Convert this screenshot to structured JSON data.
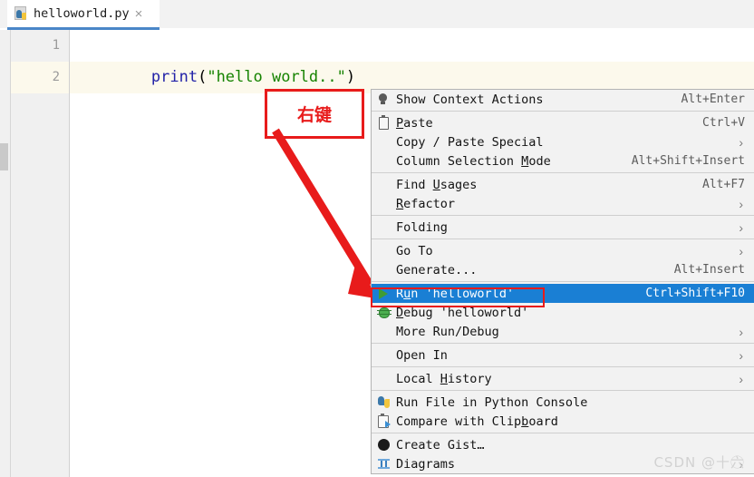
{
  "tab": {
    "filename": "helloworld.py",
    "icon": "python-file-icon",
    "close": "×",
    "underline_color": "#4a86c8"
  },
  "editor": {
    "lines": [
      {
        "number": "1",
        "highlighted": false
      },
      {
        "number": "2",
        "highlighted": true
      }
    ],
    "code": {
      "fn": "print",
      "open_paren": "(",
      "string": "\"hello world..\"",
      "close_paren": ")"
    },
    "colors": {
      "function": "#2222a8",
      "string": "#168300",
      "current_line": "#fcf9ec",
      "gutter": "#f0f0f0"
    }
  },
  "context_menu": {
    "selected_index": 11,
    "selection_color": "#1a7fd4",
    "items": [
      {
        "icon": "lightbulb-icon",
        "label": "Show Context Actions",
        "mnemonic": "",
        "shortcut": "Alt+Enter",
        "submenu": false,
        "separator_after": true
      },
      {
        "icon": "clipboard-paste-icon",
        "label": "Paste",
        "mnemonic": "P",
        "shortcut": "Ctrl+V",
        "submenu": false,
        "separator_after": false
      },
      {
        "icon": "",
        "label": "Copy / Paste Special",
        "mnemonic": "",
        "shortcut": "",
        "submenu": true,
        "separator_after": false
      },
      {
        "icon": "",
        "label": "Column Selection Mode",
        "mnemonic": "M",
        "shortcut": "Alt+Shift+Insert",
        "submenu": false,
        "separator_after": true
      },
      {
        "icon": "",
        "label": "Find Usages",
        "mnemonic": "U",
        "shortcut": "Alt+F7",
        "submenu": false,
        "separator_after": false
      },
      {
        "icon": "",
        "label": "Refactor",
        "mnemonic": "R",
        "shortcut": "",
        "submenu": true,
        "separator_after": true
      },
      {
        "icon": "",
        "label": "Folding",
        "mnemonic": "",
        "shortcut": "",
        "submenu": true,
        "separator_after": true
      },
      {
        "icon": "",
        "label": "Go To",
        "mnemonic": "",
        "shortcut": "",
        "submenu": true,
        "separator_after": false
      },
      {
        "icon": "",
        "label": "Generate...",
        "mnemonic": "",
        "shortcut": "Alt+Insert",
        "submenu": false,
        "separator_after": true
      },
      {
        "icon": "run-play-icon",
        "label": "Run 'helloworld'",
        "mnemonic": "u",
        "shortcut": "Ctrl+Shift+F10",
        "submenu": false,
        "separator_after": false,
        "selected": true
      },
      {
        "icon": "debug-bug-icon",
        "label": "Debug 'helloworld'",
        "mnemonic": "D",
        "shortcut": "",
        "submenu": false,
        "separator_after": false
      },
      {
        "icon": "",
        "label": "More Run/Debug",
        "mnemonic": "",
        "shortcut": "",
        "submenu": true,
        "separator_after": true
      },
      {
        "icon": "",
        "label": "Open In",
        "mnemonic": "",
        "shortcut": "",
        "submenu": true,
        "separator_after": true
      },
      {
        "icon": "",
        "label": "Local History",
        "mnemonic": "H",
        "shortcut": "",
        "submenu": true,
        "separator_after": true
      },
      {
        "icon": "python-icon",
        "label": "Run File in Python Console",
        "mnemonic": "",
        "shortcut": "",
        "submenu": false,
        "separator_after": false
      },
      {
        "icon": "compare-clipboard-icon",
        "label": "Compare with Clipboard",
        "mnemonic": "b",
        "shortcut": "",
        "submenu": false,
        "separator_after": true
      },
      {
        "icon": "github-icon",
        "label": "Create Gist…",
        "mnemonic": "",
        "shortcut": "",
        "submenu": false,
        "separator_after": false
      },
      {
        "icon": "diagrams-icon",
        "label": "Diagrams",
        "mnemonic": "",
        "shortcut": "",
        "submenu": true,
        "separator_after": false
      }
    ],
    "submenu_glyph": "›"
  },
  "annotation": {
    "label": "右键",
    "color": "#e81b1b",
    "arrow": "red-arrow-pointing-to-run-item"
  },
  "watermark": {
    "text": "CSDN @十六⃝"
  }
}
